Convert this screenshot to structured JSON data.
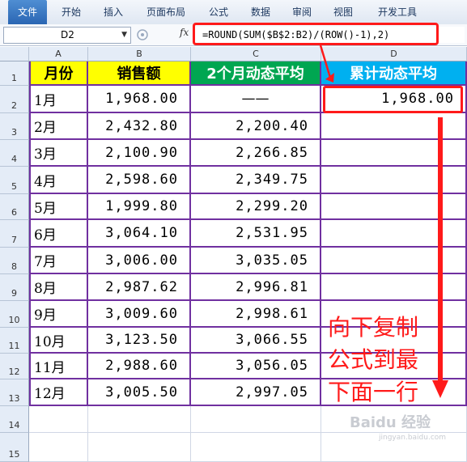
{
  "ribbon": {
    "tabs": [
      "文件",
      "开始",
      "插入",
      "页面布局",
      "公式",
      "数据",
      "审阅",
      "视图",
      "开发工具"
    ]
  },
  "formula_bar": {
    "name_box": "D2",
    "fx_label": "fx",
    "formula": "=ROUND(SUM($B$2:B2)/(ROW()-1),2)"
  },
  "columns": [
    "A",
    "B",
    "C",
    "D"
  ],
  "rows": [
    "1",
    "2",
    "3",
    "4",
    "5",
    "6",
    "7",
    "8",
    "9",
    "10",
    "11",
    "12",
    "13",
    "14",
    "15"
  ],
  "headers": {
    "month": "月份",
    "sales": "销售额",
    "avg2": "2个月动态平均",
    "cum": "累计动态平均"
  },
  "table": [
    {
      "month": "1月",
      "sales": "1,968.00",
      "avg2": "——",
      "cum": "1,968.00"
    },
    {
      "month": "2月",
      "sales": "2,432.80",
      "avg2": "2,200.40",
      "cum": ""
    },
    {
      "month": "3月",
      "sales": "2,100.90",
      "avg2": "2,266.85",
      "cum": ""
    },
    {
      "month": "4月",
      "sales": "2,598.60",
      "avg2": "2,349.75",
      "cum": ""
    },
    {
      "month": "5月",
      "sales": "1,999.80",
      "avg2": "2,299.20",
      "cum": ""
    },
    {
      "month": "6月",
      "sales": "3,064.10",
      "avg2": "2,531.95",
      "cum": ""
    },
    {
      "month": "7月",
      "sales": "3,006.00",
      "avg2": "3,035.05",
      "cum": ""
    },
    {
      "month": "8月",
      "sales": "2,987.62",
      "avg2": "2,996.81",
      "cum": ""
    },
    {
      "month": "9月",
      "sales": "3,009.60",
      "avg2": "2,998.61",
      "cum": ""
    },
    {
      "month": "10月",
      "sales": "3,123.50",
      "avg2": "3,066.55",
      "cum": ""
    },
    {
      "month": "11月",
      "sales": "2,988.60",
      "avg2": "3,056.05",
      "cum": ""
    },
    {
      "month": "12月",
      "sales": "3,005.50",
      "avg2": "2,997.05",
      "cum": ""
    }
  ],
  "annotation": {
    "lines": [
      "向下复制",
      "公式到最",
      "下面一行"
    ]
  },
  "watermark": {
    "text": "Baidu 经验",
    "sub": "jingyan.baidu.com"
  },
  "colors": {
    "header_month_bg": "#ffff00",
    "header_sales_bg": "#ffff00",
    "header_avg2_bg": "#00a651",
    "header_cum_bg": "#00b0f0",
    "table_border": "#7030a0",
    "highlight": "#ff1a1a"
  }
}
